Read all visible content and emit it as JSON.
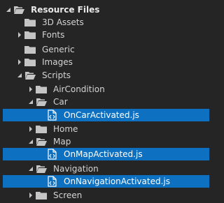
{
  "tree": {
    "root": {
      "label": "Resource Files",
      "icon": "folder-open-icon"
    },
    "items": [
      {
        "label": "3D Assets",
        "icon": "folder-icon"
      },
      {
        "label": "Fonts",
        "icon": "folder-icon"
      },
      {
        "label": "Generic",
        "icon": "folder-icon"
      },
      {
        "label": "Images",
        "icon": "folder-icon"
      },
      {
        "label": "Scripts",
        "icon": "folder-open-icon"
      },
      {
        "label": "AirCondition",
        "icon": "folder-icon"
      },
      {
        "label": "Car",
        "icon": "folder-open-icon"
      },
      {
        "label": "OnCarActivated.js",
        "icon": "js-file-icon",
        "selected": true
      },
      {
        "label": "Home",
        "icon": "folder-icon"
      },
      {
        "label": "Map",
        "icon": "folder-open-icon"
      },
      {
        "label": "OnMapActivated.js",
        "icon": "js-file-icon",
        "selected": true
      },
      {
        "label": "Navigation",
        "icon": "folder-open-icon"
      },
      {
        "label": "OnNavigationActivated.js",
        "icon": "js-file-icon",
        "selected": true
      },
      {
        "label": "Screen",
        "icon": "folder-icon"
      }
    ]
  },
  "colors": {
    "background": "#252526",
    "selection": "#0e70c0",
    "folder": "#c5c5c5",
    "text": "#d4d4d4"
  }
}
